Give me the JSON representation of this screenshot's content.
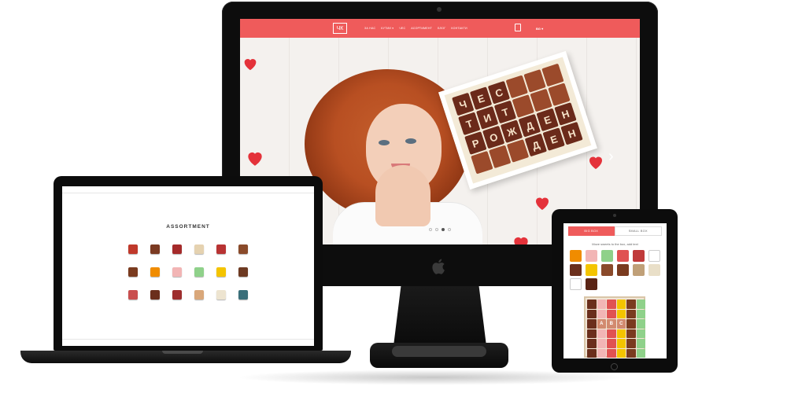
{
  "imac": {
    "site": {
      "logo_text": "ЧК",
      "menu": [
        "ЗА НАС",
        "КУТИИ ▾",
        "ЧЕС",
        "АСОРТИМЕНТ",
        "БЛОГ",
        "КОНТАКТИ"
      ],
      "lang": "BG ▾"
    },
    "hero": {
      "choco_letters": [
        "Ч",
        "Е",
        "С",
        "Т",
        "И",
        "Т",
        "Р",
        "О",
        "Ж",
        "Д",
        "Е",
        "Н",
        "Д",
        "Е",
        "Н"
      ],
      "arrow": "›",
      "dots": 4,
      "active_dot": 2
    }
  },
  "laptop": {
    "title": "ASSORTMENT",
    "items": [
      {
        "label": "",
        "color": "#c0392b"
      },
      {
        "label": "",
        "color": "#7b3a22"
      },
      {
        "label": "",
        "color": "#a52a2a"
      },
      {
        "label": "",
        "color": "#e5d2b0"
      },
      {
        "label": "",
        "color": "#b83333"
      },
      {
        "label": "",
        "color": "#8a4a2a"
      },
      {
        "label": "",
        "color": "#7a3b1f"
      },
      {
        "label": "",
        "color": "#f08c00"
      },
      {
        "label": "",
        "color": "#f2b5b5"
      },
      {
        "label": "",
        "color": "#8fd18a"
      },
      {
        "label": "",
        "color": "#f4c400"
      },
      {
        "label": "",
        "color": "#6d3a22"
      },
      {
        "label": "",
        "color": "#c94f4f"
      },
      {
        "label": "",
        "color": "#6b2f1c"
      },
      {
        "label": "",
        "color": "#9e2e2e"
      },
      {
        "label": "",
        "color": "#d9a77a"
      },
      {
        "label": "",
        "color": "#ede4d0"
      },
      {
        "label": "",
        "color": "#3a6f7a"
      }
    ]
  },
  "tablet": {
    "tabs": [
      "BIG BOX",
      "SMALL BOX"
    ],
    "active_tab": 0,
    "hint": "Move sweets to the box, add text",
    "palette": [
      "#f08c00",
      "#f2b5b5",
      "#8fd18a",
      "#e05252",
      "#c03a3a",
      "#ffffff",
      "#6b2f1c",
      "#f4c400",
      "#8a4a2a",
      "#7a3b1f",
      "#c0a078",
      "#e9dfc8",
      "#ffffff",
      "#5a2415"
    ],
    "box_letters": [
      "A",
      "B",
      "C"
    ]
  },
  "colors": {
    "brand": "#ef5b5b",
    "device": "#0c0c0c"
  }
}
